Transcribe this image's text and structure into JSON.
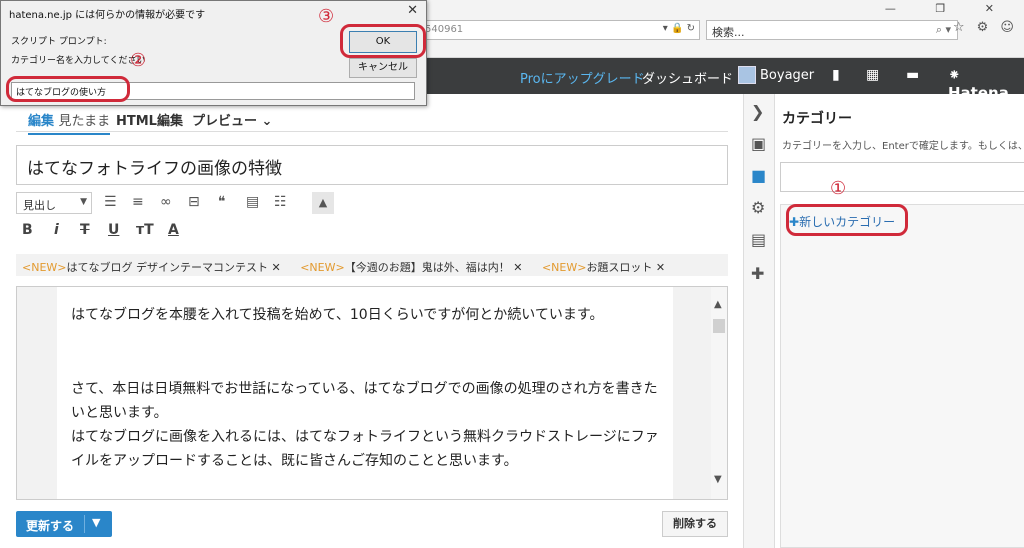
{
  "browser": {
    "address_fragment": "540961",
    "search_placeholder": "検索...",
    "search_icon": "⌕ ▾",
    "address_icons": "▾ 🔒 ↻",
    "window_controls": "— ❐ ✕",
    "toolbar_icons": "☆ ⚙ ☺"
  },
  "header": {
    "pro_upgrade": "Proにアップグレード",
    "dashboard": "ダッシュボード",
    "username": "Boyager",
    "logo": "⁕ Hatena"
  },
  "editor": {
    "tab_edit": "編集",
    "tab_edit_sub": "見たまま",
    "tab_html": "HTML編集",
    "tab_preview": "プレビュー ⌄",
    "title": "はてなフォトライフの画像の特徴",
    "format_select": "見出し",
    "notices": [
      {
        "tag": "<NEW>",
        "text": "はてなブログ デザインテーマコンテスト ✕"
      },
      {
        "tag": "<NEW>",
        "text": "【今週のお題】鬼は外、福は内！ ✕"
      },
      {
        "tag": "<NEW>",
        "text": "お題スロット ✕"
      }
    ],
    "paragraphs": [
      "はてなブログを本腰を入れて投稿を始めて、10日くらいですが何とか続いています。",
      "さて、本日は日頃無料でお世話になっている、はてなブログでの画像の処理のされ方を書きたいと思います。",
      "はてなブログに画像を入れるには、はてなフォトライフという無料クラウドストレージにファイルをアップロードすることは、既に皆さんご存知のことと思います。"
    ],
    "update_button": "更新する",
    "delete_button": "削除する"
  },
  "category_panel": {
    "title": "カテゴリー",
    "description": "カテゴリーを入力し、Enterで確定します。もしくは、",
    "new_category": "新しいカテゴリー"
  },
  "dialog": {
    "title": "hatena.ne.jp には何らかの情報が必要です",
    "label1": "スクリプト プロンプト:",
    "label2": "カテゴリー名を入力してください",
    "input_value": "はてなブログの使い方",
    "ok": "OK",
    "cancel": "キャンセル"
  },
  "annotations": {
    "n1": "①",
    "n2": "②",
    "n3": "③"
  },
  "colors": {
    "accent": "#2a86c9",
    "header_bg": "#3b3d3e",
    "annotation": "#d02a3a",
    "new_tag": "#e39a2f"
  }
}
